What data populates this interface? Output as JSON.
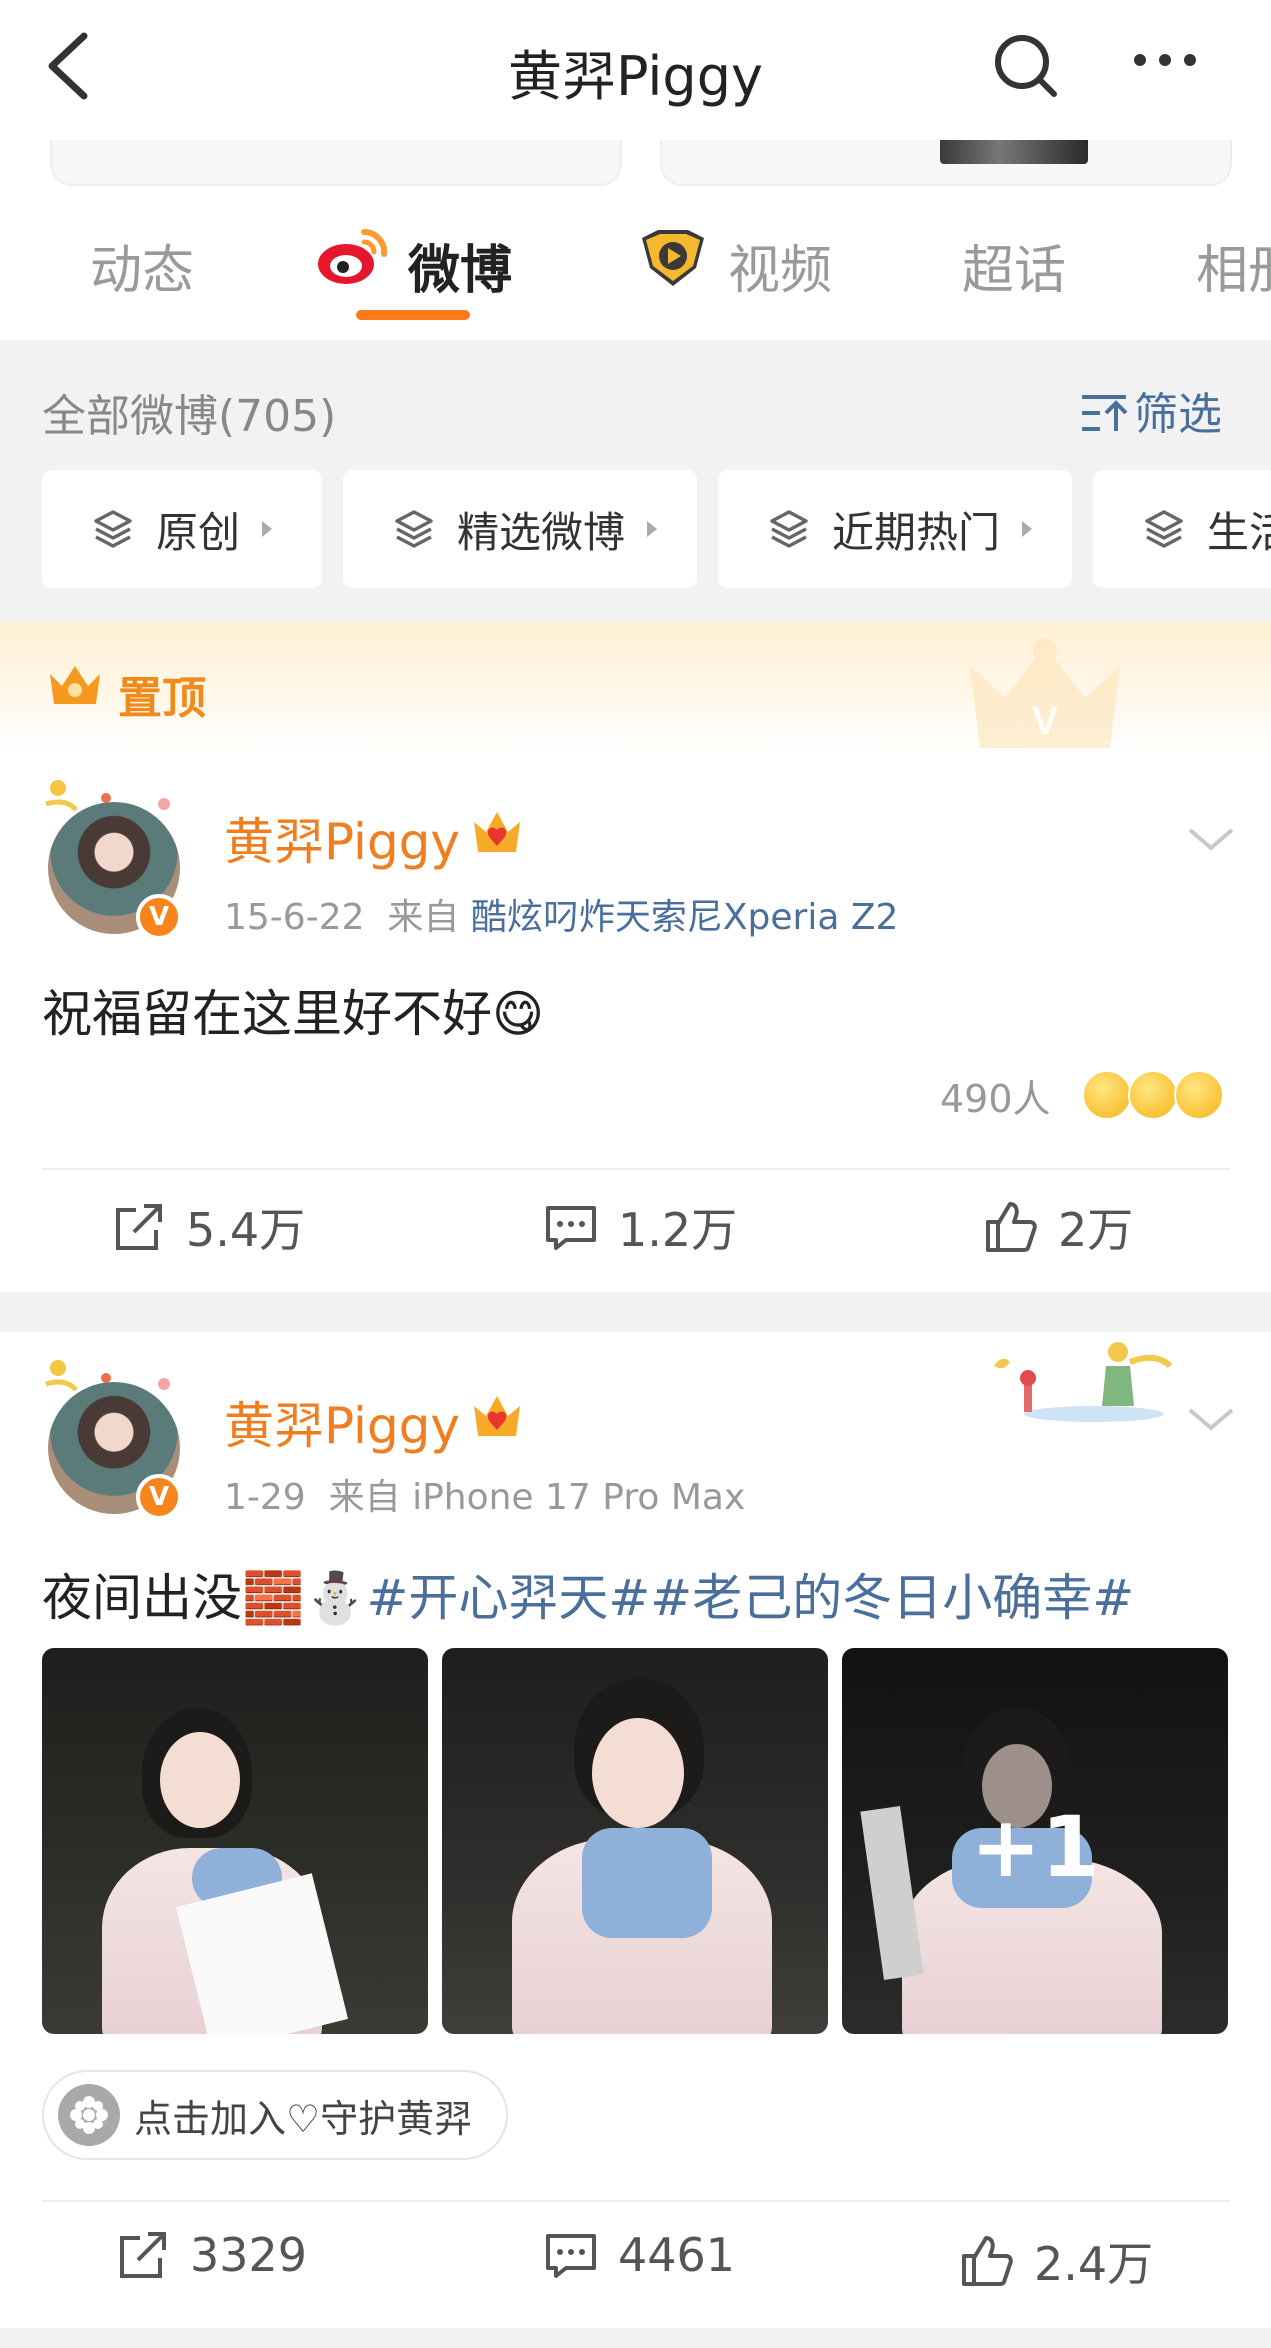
{
  "header": {
    "title": "黄羿Piggy",
    "back_icon": "chevron-left-icon",
    "search_icon": "search-icon",
    "more_icon": "more-horizontal-icon"
  },
  "tabs": [
    {
      "label": "动态",
      "active": false
    },
    {
      "label": "微博",
      "active": true,
      "icon": "weibo-logo-icon"
    },
    {
      "label": "视频",
      "active": false,
      "icon": "video-badge-icon"
    },
    {
      "label": "超话",
      "active": false
    },
    {
      "label": "相册",
      "active": false
    }
  ],
  "filters": {
    "count_label": "全部微博(705)",
    "filter_button": "筛选",
    "chips": [
      "原创",
      "精选微博",
      "近期热门",
      "生活"
    ]
  },
  "pinned_label": "置顶",
  "posts": [
    {
      "username": "黄羿Piggy",
      "date": "15-6-22",
      "source_prefix": "来自",
      "source": "酷炫叼炸天索尼Xperia Z2",
      "text": "祝福留在这里好不好😋",
      "reactions_count": "490人",
      "reposts": "5.4万",
      "comments": "1.2万",
      "likes": "2万"
    },
    {
      "username": "黄羿Piggy",
      "date": "1-29",
      "source_prefix": "来自",
      "source": "iPhone 17 Pro Max",
      "text_plain": "夜间出没🧱⛄",
      "hashtags": "#开心羿天##老己的冬日小确幸#",
      "more_photos": "+1",
      "guard_chip": "点击加入♡守护黄羿",
      "reposts": "3329",
      "comments": "4461",
      "likes": "2.4万"
    }
  ],
  "colors": {
    "accent_orange": "#ff7a1a",
    "username_orange": "#f07d1e",
    "link_blue": "#4a6f9d",
    "background_gray": "#f2f2f2"
  }
}
